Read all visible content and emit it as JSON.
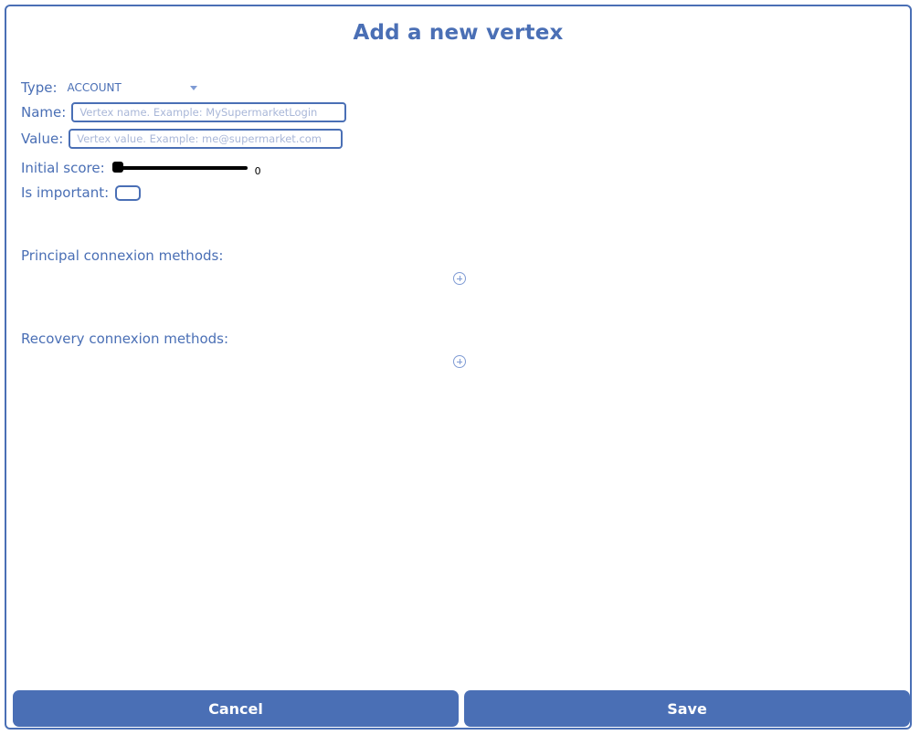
{
  "dialog": {
    "title": "Add a new vertex"
  },
  "form": {
    "type_label": "Type:",
    "type_value": "ACCOUNT",
    "name_label": "Name:",
    "name_placeholder": "Vertex name. Example: MySupermarketLogin",
    "value_label": "Value:",
    "value_placeholder": "Vertex value. Example: me@supermarket.com",
    "score_label": "Initial score:",
    "score_value": "0",
    "score_fraction": 0,
    "important_label": "Is important:"
  },
  "sections": {
    "principal_label": "Principal connexion methods:",
    "recovery_label": "Recovery connexion methods:"
  },
  "buttons": {
    "cancel_label": "Cancel",
    "save_label": "Save"
  },
  "colors": {
    "accent": "#4a6fb5",
    "placeholder": "#a9b7d8"
  }
}
